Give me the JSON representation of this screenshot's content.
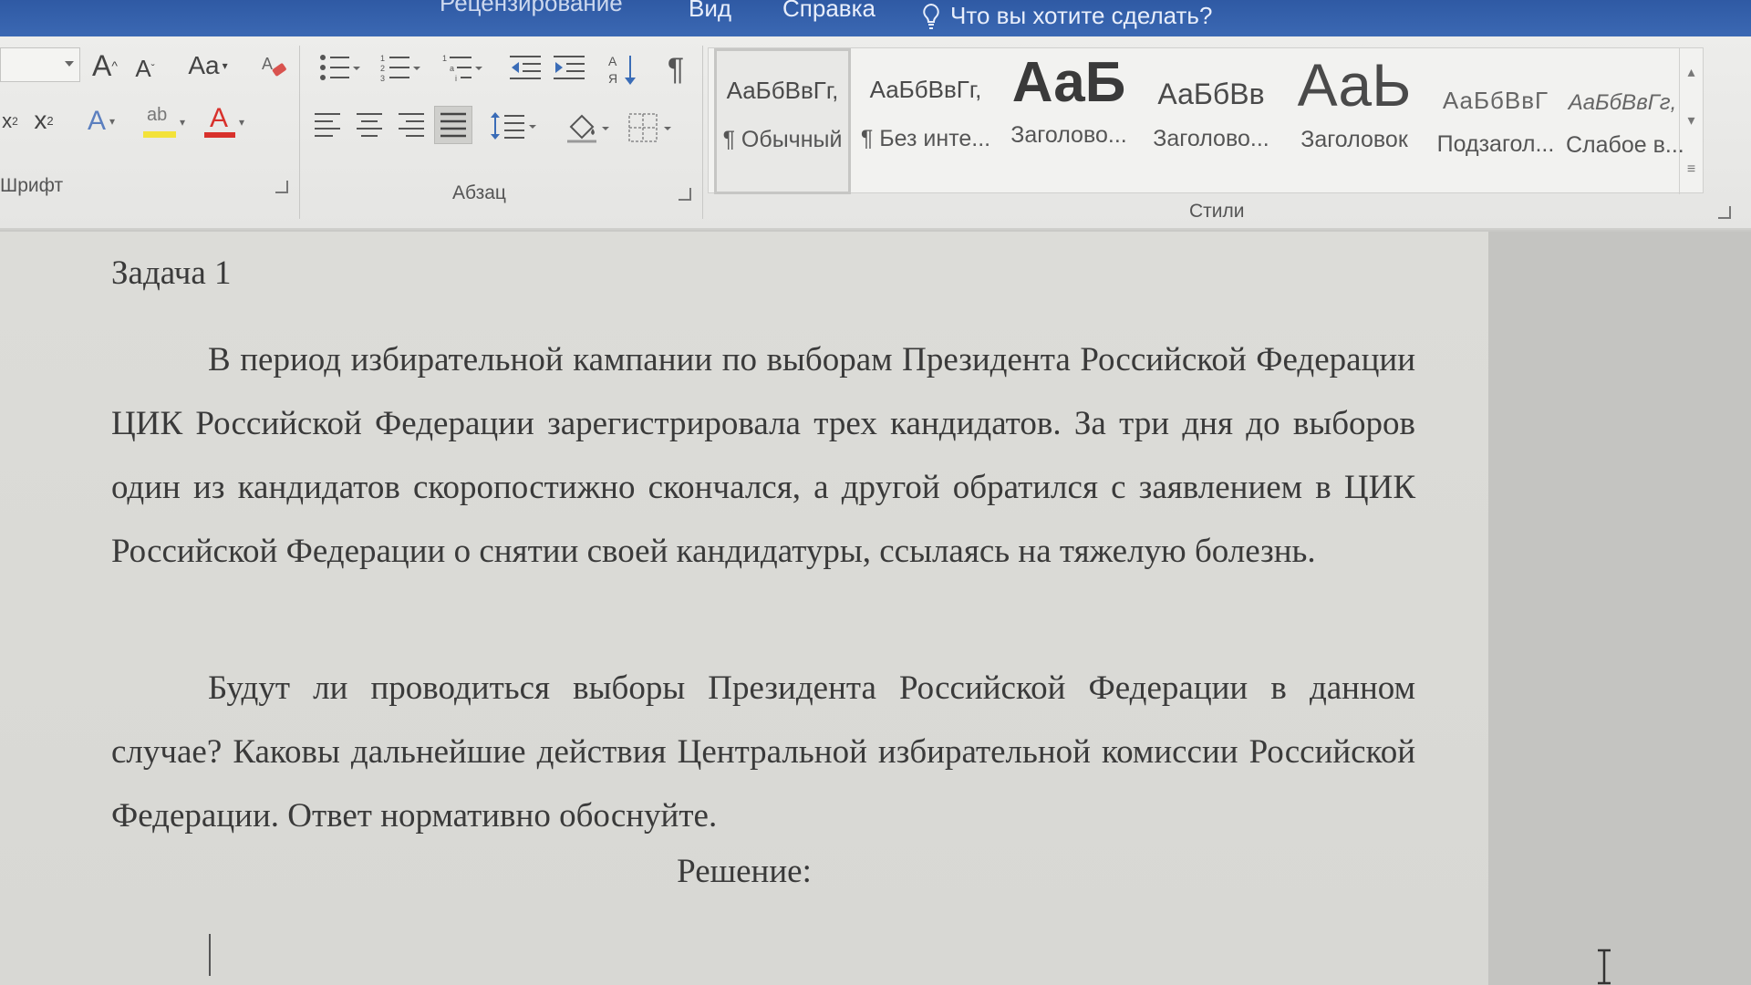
{
  "menubar": {
    "tabs": {
      "review": "Рецензирование",
      "view": "Вид",
      "help": "Справка"
    },
    "tell_me": "Что вы хотите сделать?",
    "tell_me_icon": "lightbulb-icon"
  },
  "ribbon": {
    "font_group": {
      "label": "Шрифт",
      "font_size_value": "",
      "buttons": {
        "grow_font": "A",
        "shrink_font": "A",
        "change_case": "Aa",
        "subscript": "x",
        "superscript": "x",
        "text_effects": "A",
        "highlight": "ab",
        "font_color": "A"
      },
      "colors": {
        "highlight": "#f3e23a",
        "font_color": "#d8312c"
      }
    },
    "paragraph_group": {
      "label": "Абзац"
    },
    "styles_group": {
      "label": "Стили",
      "items": [
        {
          "sample": "АаБбВвГг,",
          "name": "¶ Обычный"
        },
        {
          "sample": "АаБбВвГг,",
          "name": "¶ Без инте..."
        },
        {
          "sample": "АаБ",
          "name": "Заголово..."
        },
        {
          "sample": "АаБбВв",
          "name": "Заголово..."
        },
        {
          "sample": "АаЬ",
          "name": "Заголовок"
        },
        {
          "sample": "АаБбВвГ",
          "name": "Подзагол..."
        },
        {
          "sample": "АаБбВвГг,",
          "name": "Слабое в..."
        }
      ]
    }
  },
  "document": {
    "heading": "Задача 1",
    "paragraph1": "В период избирательной кампании по выборам Президента Российской Федерации ЦИК Российской Федерации зарегистрировала трех кандидатов. За три дня до выборов один из кандидатов скоропостижно скончался, а другой обратился с заявлением в ЦИК Российской Федерации о снятии своей кандидатуры, ссылаясь на тяжелую болезнь.",
    "paragraph2": "Будут ли проводиться выборы Президента Российской Федерации в данном случае? Каковы дальнейшие действия Центральной избирательной комиссии Российской Федерации. Ответ нормативно обоснуйте.",
    "solution_label": "Решение:"
  }
}
